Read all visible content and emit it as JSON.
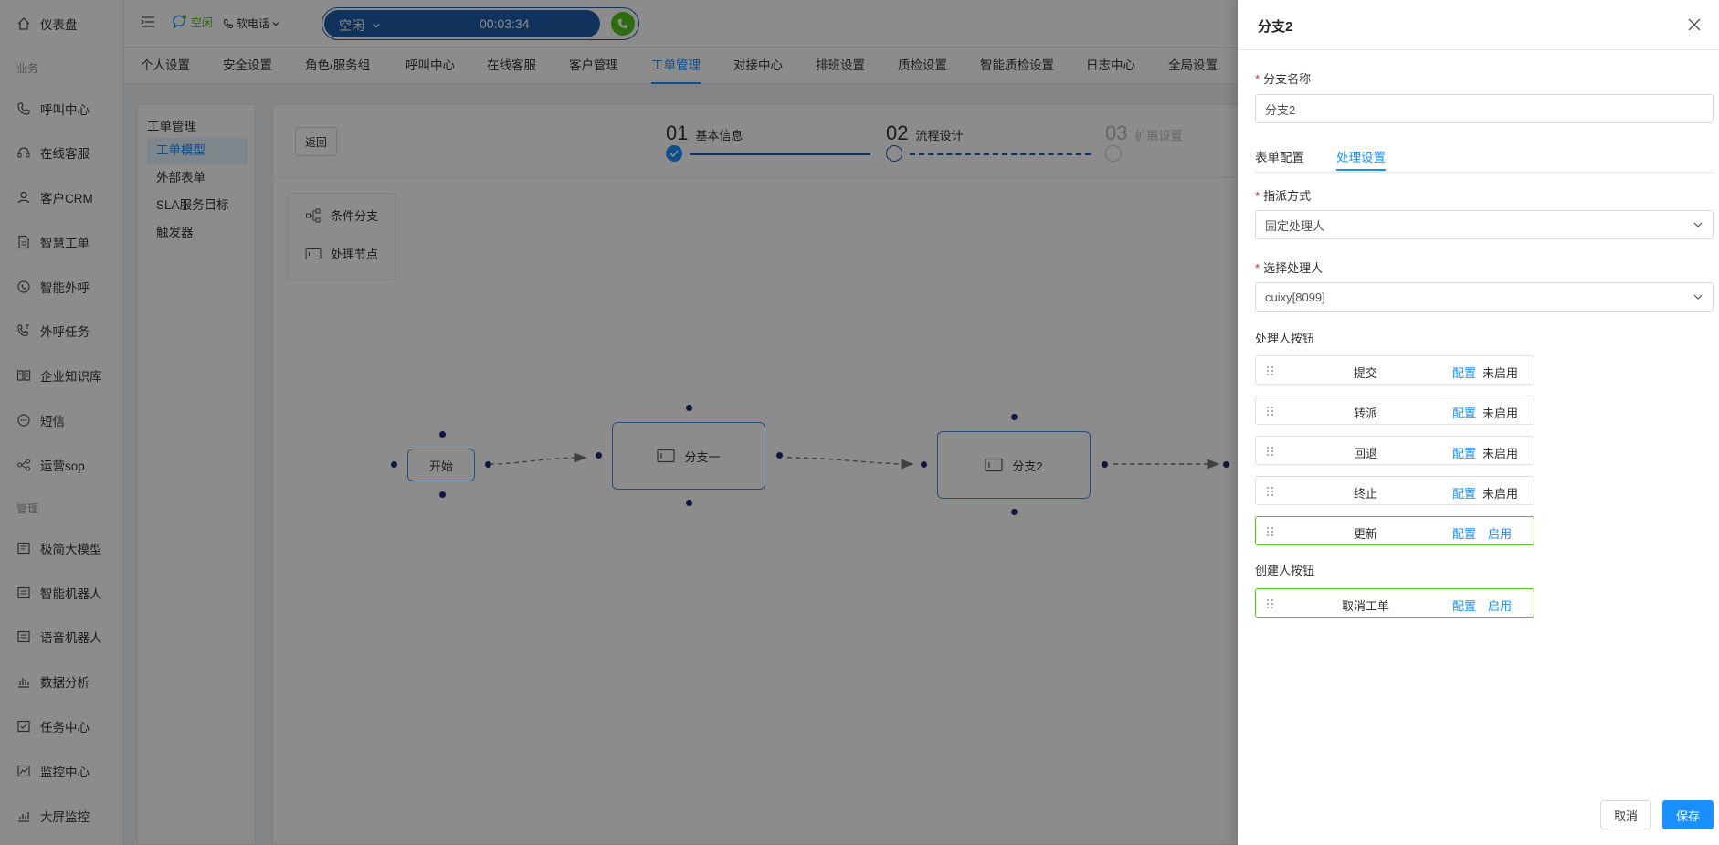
{
  "sidebar": {
    "dashboard": "仪表盘",
    "group_business": "业务",
    "group_manage": "管理",
    "items": [
      {
        "label": "呼叫中心",
        "icon": "phone-icon"
      },
      {
        "label": "在线客服",
        "icon": "headset-icon"
      },
      {
        "label": "客户CRM",
        "icon": "user-icon"
      },
      {
        "label": "智慧工单",
        "icon": "document-icon"
      },
      {
        "label": "智能外呼",
        "icon": "whatsapp-phone-icon"
      },
      {
        "label": "外呼任务",
        "icon": "phone-task-icon"
      },
      {
        "label": "企业知识库",
        "icon": "book-icon"
      },
      {
        "label": "短信",
        "icon": "sms-icon"
      },
      {
        "label": "运营sop",
        "icon": "flow-icon"
      }
    ],
    "manage_items": [
      {
        "label": "极简大模型",
        "icon": "model-icon"
      },
      {
        "label": "智能机器人",
        "icon": "robot-icon"
      },
      {
        "label": "语音机器人",
        "icon": "voice-robot-icon"
      },
      {
        "label": "数据分析",
        "icon": "bar-chart-icon"
      },
      {
        "label": "任务中心",
        "icon": "task-icon"
      },
      {
        "label": "监控中心",
        "icon": "monitor-icon"
      },
      {
        "label": "大屏监控",
        "icon": "screen-icon"
      }
    ]
  },
  "topbar": {
    "status": "空闲",
    "phone_type": "软电话",
    "call_state": "空闲",
    "timer": "00:03:34"
  },
  "tabs": [
    "个人设置",
    "安全设置",
    "角色/服务组",
    "呼叫中心",
    "在线客服",
    "客户管理",
    "工单管理",
    "对接中心",
    "排班设置",
    "质检设置",
    "智能质检设置",
    "日志中心",
    "全局设置"
  ],
  "active_tab": "工单管理",
  "submenu": {
    "title": "工单管理",
    "items": [
      "工单模型",
      "外部表单",
      "SLA服务目标",
      "触发器"
    ]
  },
  "workspace": {
    "back": "返回",
    "steps": [
      {
        "num": "01",
        "label": "基本信息",
        "state": "done"
      },
      {
        "num": "02",
        "label": "流程设计",
        "state": "active"
      },
      {
        "num": "03",
        "label": "扩展设置",
        "state": "pending"
      }
    ],
    "palette": [
      "条件分支",
      "处理节点"
    ],
    "nodes": [
      "开始",
      "分支一",
      "分支2"
    ]
  },
  "drawer": {
    "title": "分支2",
    "name_label": "分支名称",
    "name_value": "分支2",
    "tabs": [
      "表单配置",
      "处理设置"
    ],
    "assign_label": "指派方式",
    "assign_value": "固定处理人",
    "handler_label": "选择处理人",
    "handler_value": "cuixy[8099]",
    "handler_buttons_label": "处理人按钮",
    "handler_buttons": [
      {
        "name": "提交",
        "config": "配置",
        "status": "未启用",
        "enabled": false
      },
      {
        "name": "转派",
        "config": "配置",
        "status": "未启用",
        "enabled": false
      },
      {
        "name": "回退",
        "config": "配置",
        "status": "未启用",
        "enabled": false
      },
      {
        "name": "终止",
        "config": "配置",
        "status": "未启用",
        "enabled": false
      },
      {
        "name": "更新",
        "config": "配置",
        "status": "启用",
        "enabled": true
      }
    ],
    "creator_buttons_label": "创建人按钮",
    "creator_buttons": [
      {
        "name": "取消工单",
        "config": "配置",
        "status": "启用",
        "enabled": true
      }
    ],
    "cancel": "取消",
    "save": "保存"
  },
  "colors": {
    "primary": "#1890ff",
    "enabled_border": "#52c41a",
    "call_pill": "#1e5ba8"
  }
}
